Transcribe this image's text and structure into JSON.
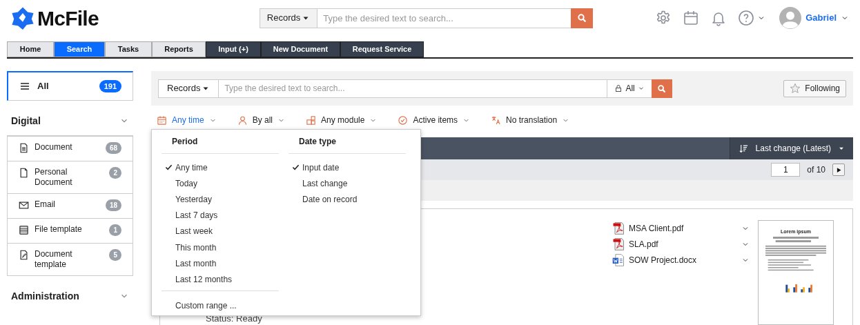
{
  "logo": {
    "text": "McFile"
  },
  "header_search": {
    "scope": "Records",
    "placeholder": "Type the desired text to search..."
  },
  "user": {
    "name": "Gabriel"
  },
  "nav_tabs": [
    {
      "label": "Home",
      "kind": "light",
      "selected": false
    },
    {
      "label": "Search",
      "kind": "light",
      "selected": true
    },
    {
      "label": "Tasks",
      "kind": "light",
      "selected": false
    },
    {
      "label": "Reports",
      "kind": "light",
      "selected": false
    },
    {
      "label": "Input (+)",
      "kind": "dark",
      "selected": false
    },
    {
      "label": "New Document",
      "kind": "dark",
      "selected": false
    },
    {
      "label": "Request Service",
      "kind": "dark",
      "selected": false
    }
  ],
  "sidebar": {
    "all": {
      "label": "All",
      "count": "191",
      "selected": true
    },
    "sections": [
      {
        "title": "Digital",
        "items": [
          {
            "label": "Document",
            "count": "68",
            "kind": "document"
          },
          {
            "label": "Personal Document",
            "count": "2",
            "kind": "page"
          },
          {
            "label": "Email",
            "count": "18",
            "kind": "email"
          },
          {
            "label": "File template",
            "count": "1",
            "kind": "list"
          },
          {
            "label": "Document template",
            "count": "5",
            "kind": "template"
          }
        ]
      },
      {
        "title": "Administration"
      }
    ]
  },
  "search": {
    "scope": "Records",
    "placeholder": "Type the desired text to search...",
    "filter": "All",
    "following": "Following"
  },
  "filters": [
    {
      "label": "Any time",
      "kind": "calendar",
      "active": true
    },
    {
      "label": "By all",
      "kind": "person",
      "active": false
    },
    {
      "label": "Any module",
      "kind": "modules",
      "active": false
    },
    {
      "label": "Active items",
      "kind": "check",
      "active": false
    },
    {
      "label": "No translation",
      "kind": "translate",
      "active": false
    }
  ],
  "sort": {
    "label": "Last change (Latest)"
  },
  "pager": {
    "page": "1",
    "total": "of 10"
  },
  "result": {
    "status": "Status: Ready",
    "attachments": [
      {
        "name": "MSA Client.pdf",
        "kind": "pdf"
      },
      {
        "name": "SLA.pdf",
        "kind": "pdf"
      },
      {
        "name": "SOW Project.docx",
        "kind": "word"
      }
    ],
    "thumbnail": {
      "title": "Lorem ipsum"
    }
  },
  "dropdown": {
    "columns": [
      {
        "title": "Period",
        "items": [
          {
            "label": "Any time",
            "selected": true
          },
          {
            "label": "Today",
            "selected": false
          },
          {
            "label": "Yesterday",
            "selected": false
          },
          {
            "label": "Last 7 days",
            "selected": false
          },
          {
            "label": "Last week",
            "selected": false
          },
          {
            "label": "This month",
            "selected": false
          },
          {
            "label": "Last month",
            "selected": false
          },
          {
            "label": "Last 12 months",
            "selected": false
          }
        ],
        "footer": "Custom range ..."
      },
      {
        "title": "Date type",
        "items": [
          {
            "label": "Input date",
            "selected": true
          },
          {
            "label": "Last change",
            "selected": false
          },
          {
            "label": "Date on record",
            "selected": false
          }
        ]
      }
    ]
  }
}
